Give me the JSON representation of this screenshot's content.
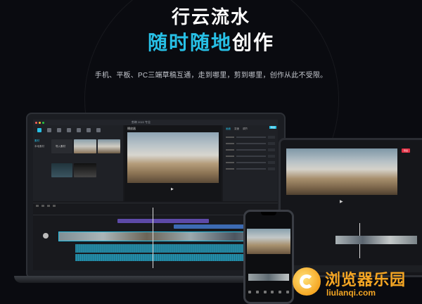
{
  "hero": {
    "title": "行云流水",
    "subtitle_accent": "随时随地",
    "subtitle_rest": "创作",
    "description": "手机、平板、PC三端草稿互通，走到哪里，剪到哪里，创作从此不受限。"
  },
  "laptop_app": {
    "window_title": "剪映 2022 专业",
    "preview_label": "播放器",
    "export_label": "导出",
    "side_items": [
      "素材",
      "本地素材"
    ],
    "media_items": [
      "导入素材"
    ],
    "right_tabs": [
      "画面",
      "变速",
      "调节"
    ]
  },
  "tablet_app": {
    "export_label": "导出"
  },
  "watermark": {
    "name": "浏览器乐园",
    "url": "liulanqi.com"
  },
  "colors": {
    "accent": "#27c0e6",
    "background": "#0a0b10",
    "watermark": "#f5a623",
    "tablet_export": "#e23347"
  }
}
